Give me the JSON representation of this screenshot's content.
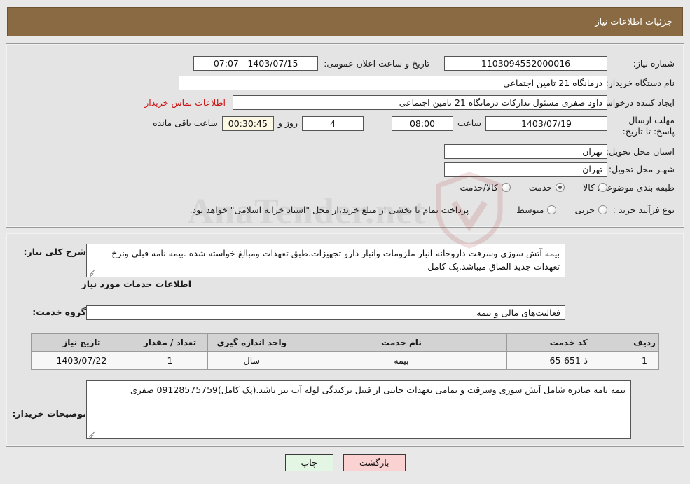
{
  "header": {
    "title": "جزئیات اطلاعات نیاز"
  },
  "top_panel": {
    "need_number": {
      "label": "شماره نیاز:",
      "value": "1103094552000016"
    },
    "announce": {
      "label": "تاریخ و ساعت اعلان عمومی:",
      "value": "1403/07/15 - 07:07"
    },
    "buyer_org": {
      "label": "نام دستگاه خریدار:",
      "value": "درمانگاه 21 تامین اجتماعی"
    },
    "requester": {
      "label": "ایجاد کننده درخواست:",
      "value": "داود صفری مسئول تدارکات درمانگاه 21 تامین اجتماعی",
      "contact_link": "اطلاعات تماس خریدار"
    },
    "deadline": {
      "label": "مهلت ارسال پاسخ: تا تاریخ:",
      "date": "1403/07/19",
      "time_label": "ساعت",
      "time": "08:00",
      "days": "4",
      "days_label": "روز و",
      "remaining": "00:30:45",
      "remaining_label": "ساعت باقی مانده"
    },
    "province": {
      "label": "استان محل تحویل:",
      "value": "تهران"
    },
    "city": {
      "label": "شهـر محل تحویل:",
      "value": "تهران"
    },
    "category": {
      "label": "طبقه بندی موضوعی:",
      "options": [
        {
          "label": "کالا",
          "checked": false
        },
        {
          "label": "خدمت",
          "checked": true
        },
        {
          "label": "کالا/خدمت",
          "checked": false
        }
      ]
    },
    "process": {
      "label": "نوع فرآیند خرید :",
      "options": [
        {
          "label": "جزیی",
          "checked": false
        },
        {
          "label": "متوسط",
          "checked": false
        }
      ],
      "note": "پرداخت تمام یا بخشی از مبلغ خرید،از محل \"اسناد خزانه اسلامی\" خواهد بود."
    }
  },
  "bottom_panel": {
    "general_desc": {
      "label": "شرح کلی نیاز:",
      "value": "بیمه آتش سوزی وسرقت داروخانه-انبار ملزومات وانبار دارو تجهیزات.طبق تعهدات ومبالغ خواسته شده .بیمه نامه قبلی ونرخ تعهدات جدید الصاق میباشد.پک کامل"
    },
    "services_heading": "اطلاعات خدمات مورد نیاز",
    "service_group": {
      "label": "گروه خدمت:",
      "value": "فعالیت‌های مالی و بیمه"
    },
    "table": {
      "columns": [
        "ردیف",
        "کد خدمت",
        "نام خدمت",
        "واحد اندازه گیری",
        "تعداد / مقدار",
        "تاریخ نیاز"
      ],
      "rows": [
        {
          "row_no": "1",
          "service_code": "ذ-651-65",
          "service_name": "بیمه",
          "unit": "سال",
          "quantity": "1",
          "need_date": "1403/07/22"
        }
      ]
    },
    "buyer_notes": {
      "label": "توضیحات خریدار:",
      "value": "بیمه نامه صادره شامل آتش سوزی وسرقت و تمامی تعهدات جانبی از قبیل ترکیدگی لوله آب نیز باشد.(پک کامل)09128575759 صفری"
    }
  },
  "footer": {
    "print_label": "چاپ",
    "back_label": "بازگشت"
  },
  "watermark": {
    "text": "AnaTender.net"
  }
}
